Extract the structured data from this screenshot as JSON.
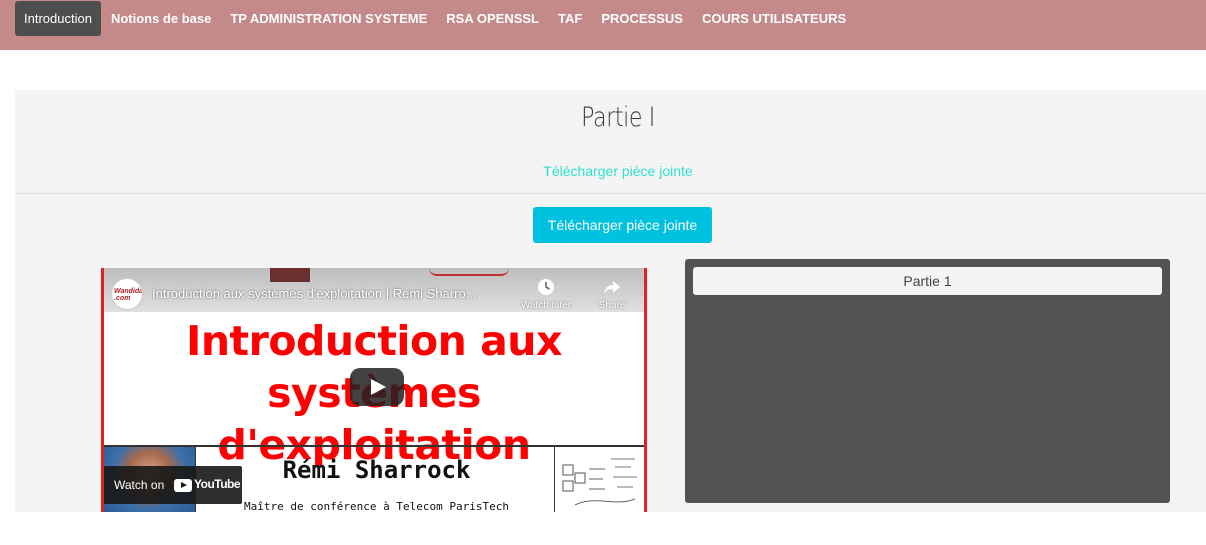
{
  "nav": {
    "items": [
      {
        "label": "Introduction",
        "active": true
      },
      {
        "label": "Notions de base",
        "active": false
      },
      {
        "label": "TP ADMINISTRATION SYSTEME",
        "active": false
      },
      {
        "label": "RSA OPENSSL",
        "active": false
      },
      {
        "label": "TAF",
        "active": false
      },
      {
        "label": "PROCESSUS",
        "active": false
      },
      {
        "label": "COURS UTILISATEURS",
        "active": false
      }
    ],
    "active_color": "#4e4e4e",
    "bar_color": "#c48a8a"
  },
  "section": {
    "title": "Partie I",
    "attachment_link": "Télécharger pièce jointe",
    "download_button": "Télécharger pièce jointe"
  },
  "video": {
    "title": "Introduction aux systèmes d'exploitation | Rémi Sharro...",
    "watch_later": "Watch later",
    "share": "Share",
    "channel_logo_text": "Wandida .com",
    "heading_line1": "Introduction aux",
    "heading_line2": "systèmes d'exploitation",
    "author": "Rémi Sharrock",
    "subtitle": "Maître de conférence à Telecom ParisTech",
    "watch_on": "Watch on",
    "youtube": "YouTube"
  },
  "sidebar": {
    "tab_label": "Partie 1"
  },
  "colors": {
    "accent": "#00c2e0",
    "link": "#2fe0d0",
    "panel_bg": "#f4f4f4",
    "side_box": "#535353"
  }
}
